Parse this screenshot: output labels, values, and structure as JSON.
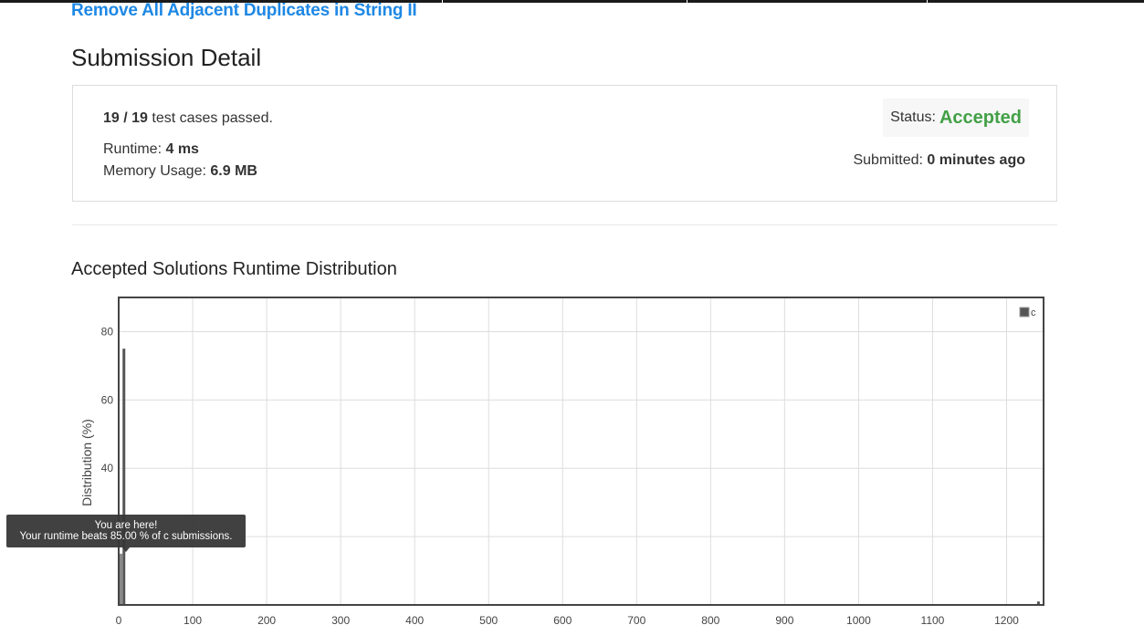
{
  "problem": {
    "title": "Remove All Adjacent Duplicates in String II"
  },
  "page": {
    "title": "Submission Detail"
  },
  "detail": {
    "cases_passed": "19 / 19",
    "cases_suffix": "test cases passed.",
    "runtime_label": "Runtime:",
    "runtime_value": "4 ms",
    "memory_label": "Memory Usage:",
    "memory_value": "6.9 MB",
    "status_label": "Status:",
    "status_value": "Accepted",
    "submitted_label": "Submitted:",
    "submitted_value": "0 minutes ago"
  },
  "distribution": {
    "title": "Accepted Solutions Runtime Distribution"
  },
  "tooltip": {
    "line1": "You are here!",
    "line2": "Your runtime beats 85.00 % of c submissions."
  },
  "colors": {
    "link": "#1e88e5",
    "accepted": "#43a047",
    "bars": "#555555",
    "highlight_bar": "#888888",
    "axis": "#444444",
    "grid": "#dddddd"
  },
  "chart_data": {
    "type": "bar",
    "ylabel": "Distribution (%)",
    "x_ticks": [
      "0",
      "100",
      "200",
      "300",
      "400",
      "500",
      "600",
      "700",
      "800",
      "900",
      "1000",
      "1100",
      "1200"
    ],
    "y_ticks": [
      "20",
      "40",
      "60",
      "80"
    ],
    "xlim": [
      0,
      1250
    ],
    "ylim": [
      0,
      90
    ],
    "grid": true,
    "legend_position": "top-right",
    "series": [
      {
        "name": "c",
        "x": [
          0,
          4,
          1240
        ],
        "values": [
          15,
          75,
          1
        ]
      }
    ],
    "highlight": {
      "x": 0,
      "value": 15
    }
  }
}
